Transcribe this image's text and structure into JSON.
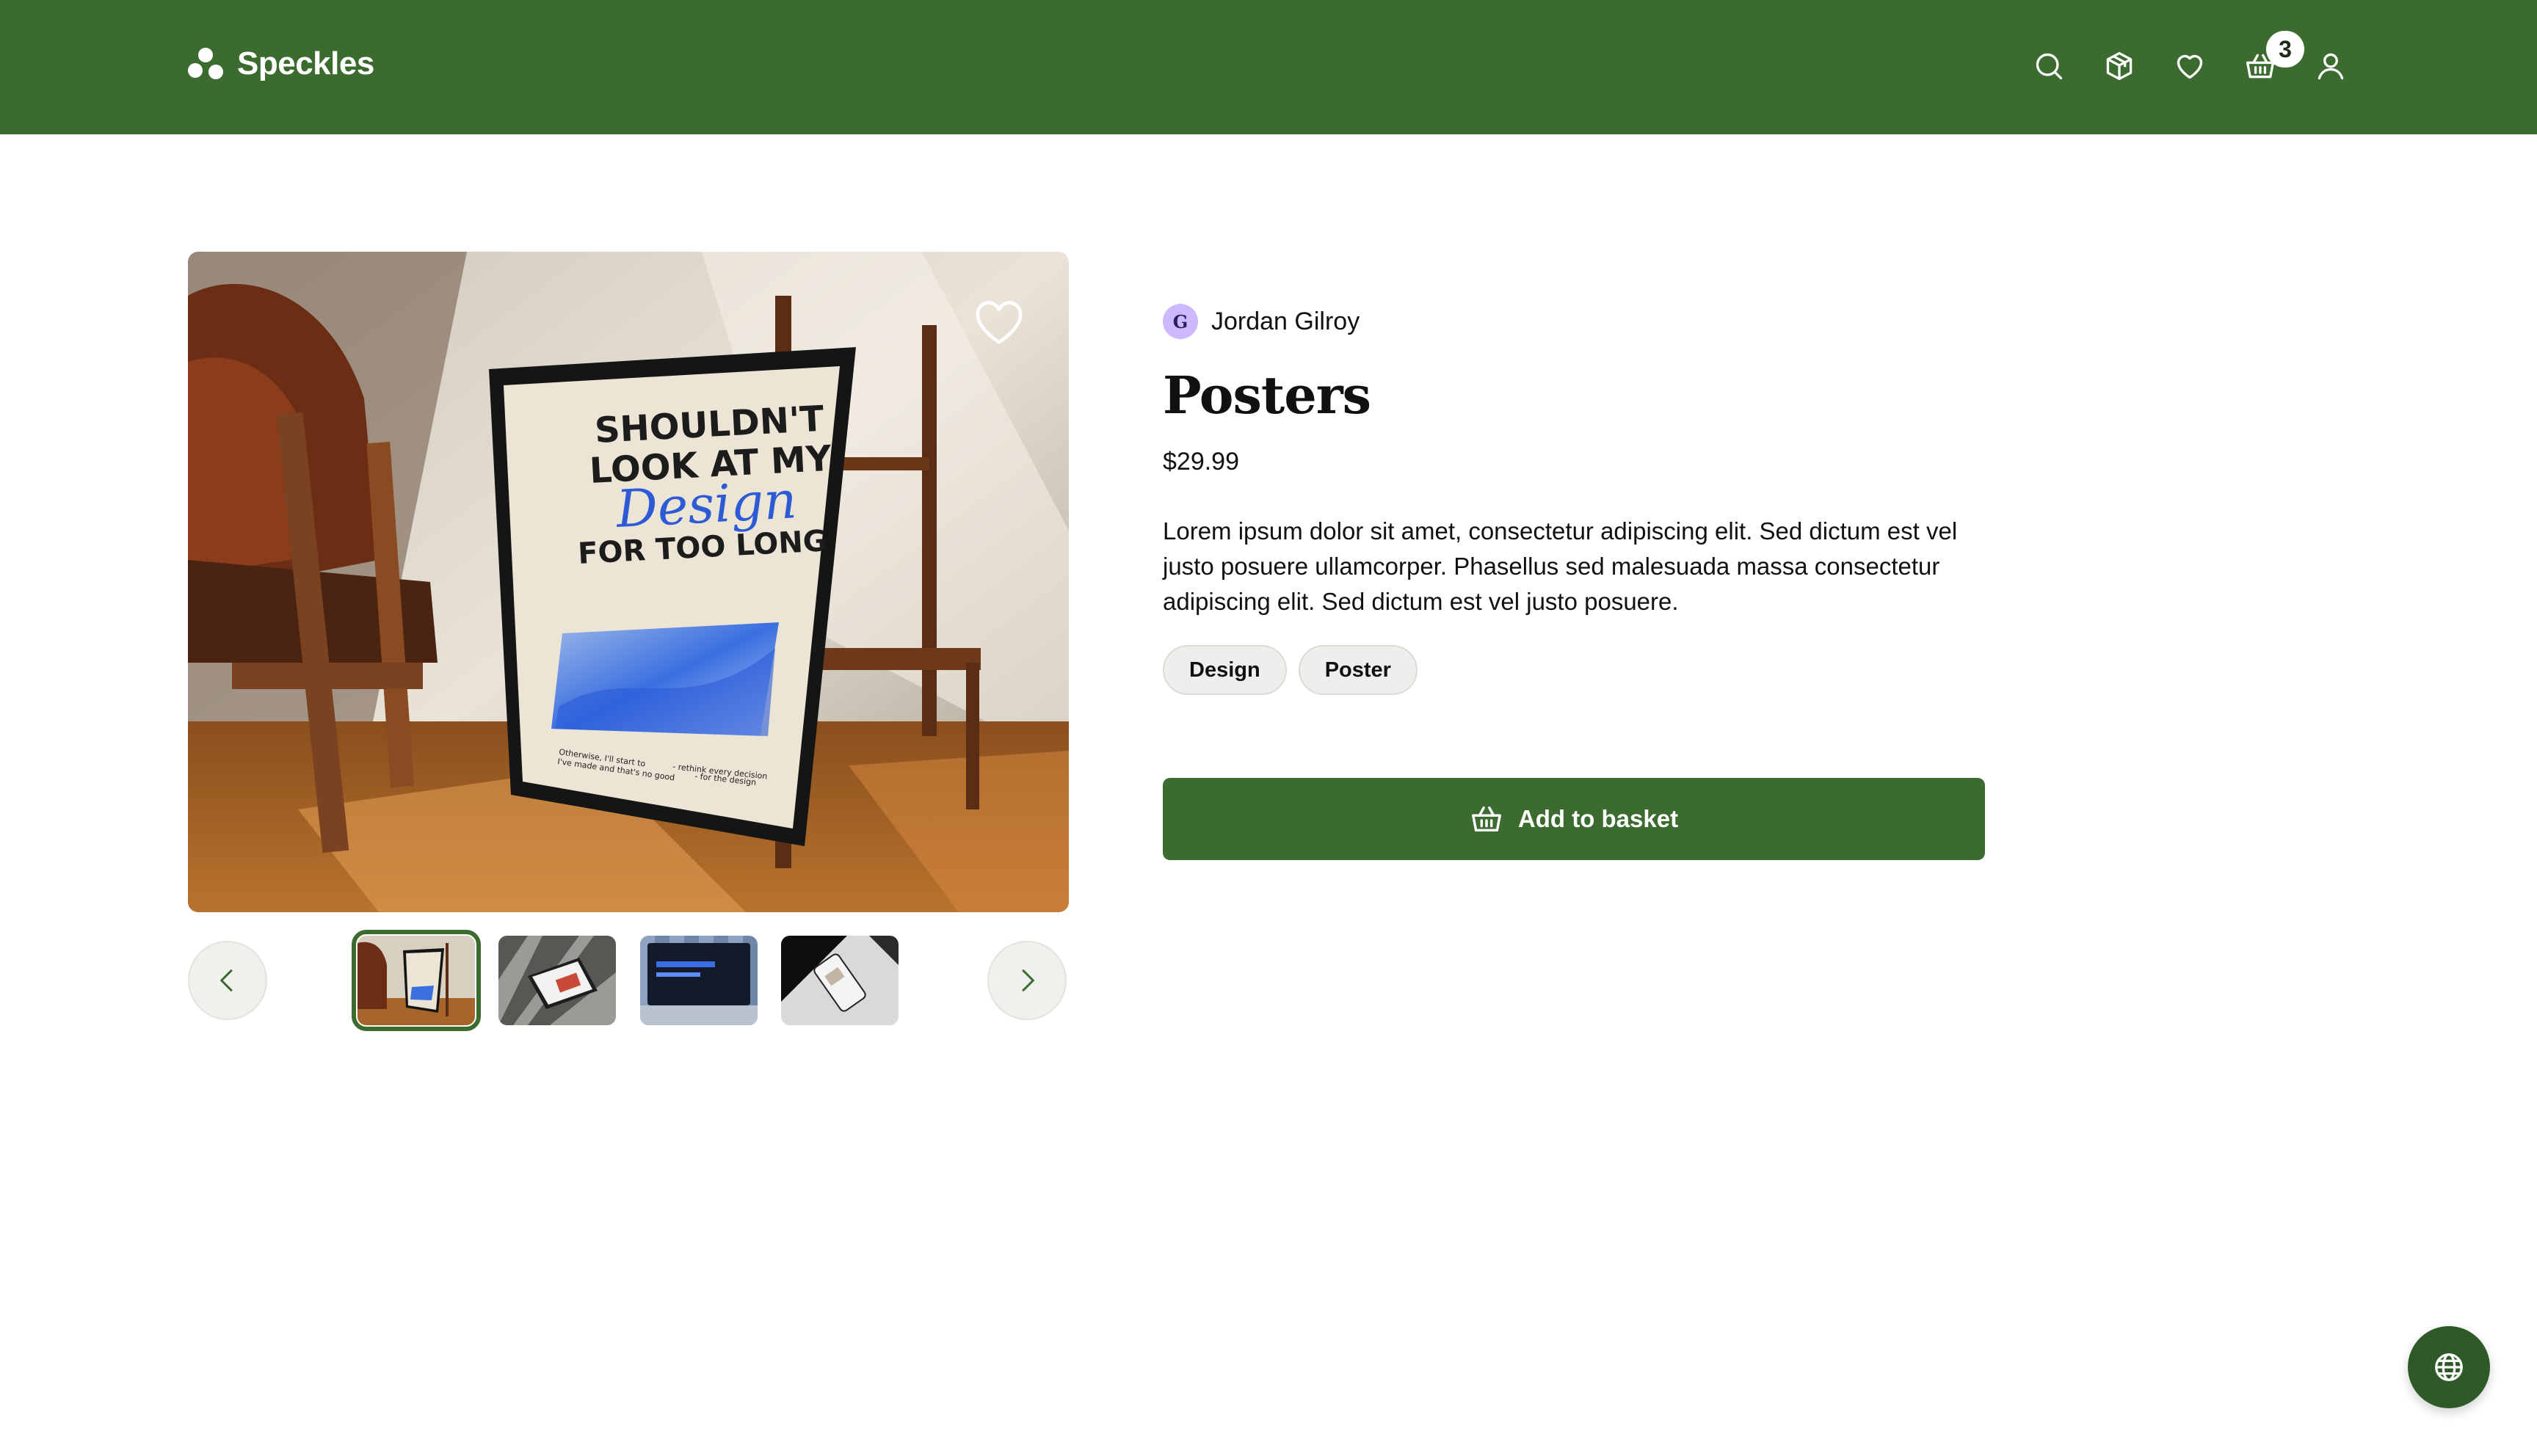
{
  "brand": {
    "name": "Speckles"
  },
  "header": {
    "icons": [
      "search-icon",
      "box-icon",
      "heart-icon",
      "basket-icon",
      "user-icon"
    ],
    "cart_count": "3"
  },
  "gallery": {
    "poster_lines": [
      "SHOULDN'T",
      "LOOK AT MY",
      "Design",
      "FOR TOO LONG"
    ],
    "poster_small_left": [
      "Otherwise, I'll start to",
      "I've made and that's no good"
    ],
    "poster_small_right": [
      "- rethink every decision",
      "- for the design"
    ],
    "thumbnails": [
      "thumbnail-poster",
      "thumbnail-laptop-shadow",
      "thumbnail-laptop-blue",
      "thumbnail-phone"
    ],
    "active_thumbnail": 0
  },
  "product": {
    "author_initial": "G",
    "author": "Jordan Gilroy",
    "title": "Posters",
    "price": "$29.99",
    "description": "Lorem ipsum dolor sit amet, consectetur adipiscing elit. Sed dictum est vel justo posuere ullamcorper. Phasellus sed malesuada massa consectetur adipiscing elit. Sed dictum est vel justo posuere.",
    "tags": [
      "Design",
      "Poster"
    ],
    "add_to_basket": "Add to basket"
  },
  "colors": {
    "brand_green": "#3c6b30",
    "badge_bg": "#ffffff",
    "tag_bg": "#ecefeb"
  }
}
